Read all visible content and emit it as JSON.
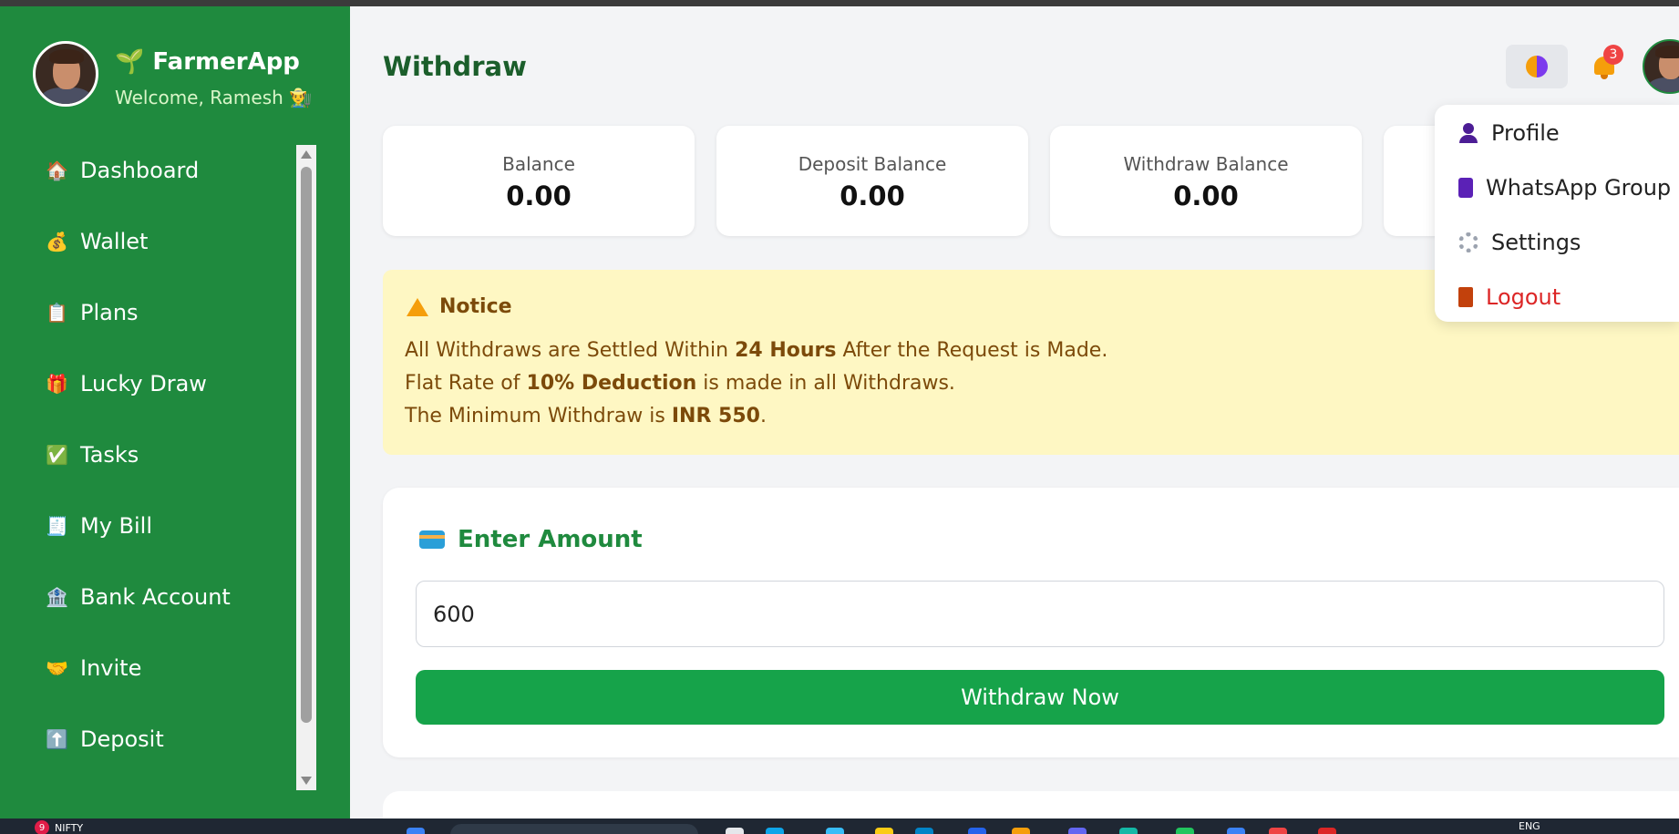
{
  "brand": {
    "title": "🌱 FarmerApp",
    "welcome": "Welcome, Ramesh 👨‍🌾"
  },
  "nav": [
    {
      "icon": "🏠",
      "label": "Dashboard"
    },
    {
      "icon": "💰",
      "label": "Wallet"
    },
    {
      "icon": "📋",
      "label": "Plans"
    },
    {
      "icon": "🎁",
      "label": "Lucky Draw"
    },
    {
      "icon": "✅",
      "label": "Tasks"
    },
    {
      "icon": "🧾",
      "label": "My Bill"
    },
    {
      "icon": "🏦",
      "label": "Bank Account"
    },
    {
      "icon": "🤝",
      "label": "Invite"
    },
    {
      "icon": "⬆️",
      "label": "Deposit"
    }
  ],
  "header": {
    "title": "Withdraw",
    "notification_count": "3"
  },
  "stats": [
    {
      "label": "Balance",
      "value": "0.00"
    },
    {
      "label": "Deposit Balance",
      "value": "0.00"
    },
    {
      "label": "Withdraw Balance",
      "value": "0.00"
    }
  ],
  "notice": {
    "title": "Notice",
    "line1": {
      "a": "All Withdraws are Settled Within ",
      "b": "24 Hours",
      "c": " After the Request is Made."
    },
    "line2": {
      "a": "Flat Rate of ",
      "b": "10% Deduction",
      "c": " is made in all Withdraws."
    },
    "line3": {
      "a": "The Minimum Withdraw is ",
      "b": "INR 550",
      "c": "."
    }
  },
  "form": {
    "heading": "Enter Amount",
    "amount_value": "600",
    "submit_label": "Withdraw Now"
  },
  "dropdown": {
    "profile": "Profile",
    "whatsapp": "WhatsApp Group",
    "settings": "Settings",
    "logout": "Logout"
  },
  "taskbar": {
    "left_badge": "9",
    "left_label": "NIFTY",
    "right_label": "ENG"
  },
  "colors": {
    "sidebar": "#1f8a3e",
    "accent_green": "#16a34a",
    "notice_bg": "#fef7c3",
    "logout_red": "#dc2626"
  }
}
